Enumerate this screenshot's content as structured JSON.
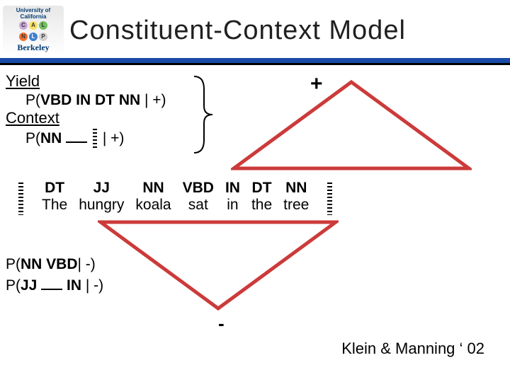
{
  "header": {
    "title": "Constituent-Context Model",
    "logo": {
      "top": "University of California",
      "letters": [
        "C",
        "A",
        "L",
        "N",
        "L",
        "P"
      ],
      "bottom": "Berkeley"
    }
  },
  "yield": {
    "label": "Yield",
    "expr_prefix": "P(",
    "expr_bold": "VBD IN DT NN",
    "expr_suffix": " | +)"
  },
  "context": {
    "label": "Context",
    "expr_prefix": "P(",
    "expr_bold_a": "NN",
    "expr_suffix": " | +)"
  },
  "plus_symbol": "+",
  "minus_symbol": "-",
  "sentence": [
    {
      "tag": "DT",
      "word": "The"
    },
    {
      "tag": "JJ",
      "word": "hungry"
    },
    {
      "tag": "NN",
      "word": "koala"
    },
    {
      "tag": "VBD",
      "word": "sat"
    },
    {
      "tag": "IN",
      "word": "in"
    },
    {
      "tag": "DT",
      "word": "the"
    },
    {
      "tag": "NN",
      "word": "tree"
    }
  ],
  "neg": {
    "line1_prefix": "P(",
    "line1_bold": "NN VBD",
    "line1_suffix": "| -)",
    "line2_prefix": "P(",
    "line2_bold_a": "JJ",
    "line2_bold_b": "IN",
    "line2_suffix": " | -)"
  },
  "citation": "Klein & Manning ‘ 02"
}
